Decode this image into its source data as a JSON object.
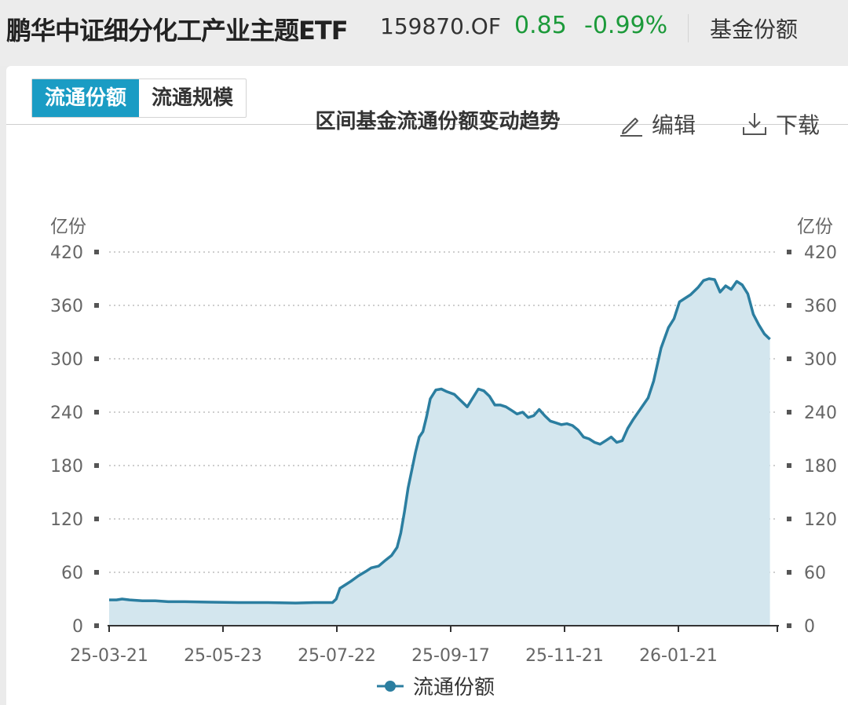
{
  "header": {
    "fund_name": "鹏华中证细分化工产业主题ETF",
    "fund_code": "159870.OF",
    "price": "0.85",
    "change": "-0.99%",
    "link": "基金份额"
  },
  "tabs": [
    {
      "label": "流通份额",
      "active": true
    },
    {
      "label": "流通规模",
      "active": false
    }
  ],
  "toolbar": {
    "edit_label": "编辑",
    "download_label": "下载"
  },
  "colors": {
    "line": "#2b7ea0",
    "fill": "#d3e6ee",
    "up": "#1c9a3a",
    "tab_active": "#1a9cc4"
  },
  "chart_data": {
    "type": "area",
    "title": "区间基金流通份额变动趋势",
    "unit_left": "亿份",
    "unit_right": "亿份",
    "ylim": [
      0,
      420
    ],
    "yticks": [
      0,
      60,
      120,
      180,
      240,
      300,
      360,
      420
    ],
    "xtick_labels": [
      "25-03-21",
      "25-05-23",
      "25-07-22",
      "25-09-17",
      "25-11-21",
      "26-01-21"
    ],
    "xlim": [
      "2025-03-21",
      "2026-03-18"
    ],
    "grid": true,
    "legend_position": "bottom",
    "series": [
      {
        "name": "流通份额",
        "points": [
          [
            "2025-03-21",
            29
          ],
          [
            "2025-03-25",
            29
          ],
          [
            "2025-03-28",
            30
          ],
          [
            "2025-04-01",
            29
          ],
          [
            "2025-04-08",
            28
          ],
          [
            "2025-04-15",
            28
          ],
          [
            "2025-04-22",
            27
          ],
          [
            "2025-05-01",
            27
          ],
          [
            "2025-05-15",
            26.5
          ],
          [
            "2025-05-30",
            26
          ],
          [
            "2025-06-15",
            26
          ],
          [
            "2025-06-30",
            25.5
          ],
          [
            "2025-07-10",
            26
          ],
          [
            "2025-07-20",
            26
          ],
          [
            "2025-07-22",
            30
          ],
          [
            "2025-07-24",
            42
          ],
          [
            "2025-07-27",
            46
          ],
          [
            "2025-07-30",
            50
          ],
          [
            "2025-08-03",
            56
          ],
          [
            "2025-08-07",
            61
          ],
          [
            "2025-08-10",
            65
          ],
          [
            "2025-08-14",
            67
          ],
          [
            "2025-08-18",
            74
          ],
          [
            "2025-08-21",
            79
          ],
          [
            "2025-08-24",
            88
          ],
          [
            "2025-08-26",
            104
          ],
          [
            "2025-08-28",
            128
          ],
          [
            "2025-08-30",
            155
          ],
          [
            "2025-09-01",
            175
          ],
          [
            "2025-09-03",
            195
          ],
          [
            "2025-09-05",
            212
          ],
          [
            "2025-09-07",
            218
          ],
          [
            "2025-09-09",
            235
          ],
          [
            "2025-09-11",
            255
          ],
          [
            "2025-09-14",
            265
          ],
          [
            "2025-09-17",
            266
          ],
          [
            "2025-09-20",
            263
          ],
          [
            "2025-09-24",
            260
          ],
          [
            "2025-09-28",
            252
          ],
          [
            "2025-10-01",
            246
          ],
          [
            "2025-10-04",
            256
          ],
          [
            "2025-10-07",
            266
          ],
          [
            "2025-10-10",
            264
          ],
          [
            "2025-10-13",
            258
          ],
          [
            "2025-10-16",
            248
          ],
          [
            "2025-10-19",
            248
          ],
          [
            "2025-10-22",
            246
          ],
          [
            "2025-10-25",
            242
          ],
          [
            "2025-10-28",
            238
          ],
          [
            "2025-10-31",
            240
          ],
          [
            "2025-11-03",
            234
          ],
          [
            "2025-11-06",
            236
          ],
          [
            "2025-11-09",
            243
          ],
          [
            "2025-11-12",
            236
          ],
          [
            "2025-11-15",
            230
          ],
          [
            "2025-11-18",
            228
          ],
          [
            "2025-11-21",
            226
          ],
          [
            "2025-11-24",
            227
          ],
          [
            "2025-11-27",
            225
          ],
          [
            "2025-11-30",
            220
          ],
          [
            "2025-12-03",
            212
          ],
          [
            "2025-12-06",
            210
          ],
          [
            "2025-12-09",
            206
          ],
          [
            "2025-12-12",
            204
          ],
          [
            "2025-12-15",
            208
          ],
          [
            "2025-12-18",
            212
          ],
          [
            "2025-12-21",
            206
          ],
          [
            "2025-12-24",
            208
          ],
          [
            "2025-12-27",
            222
          ],
          [
            "2025-12-30",
            232
          ],
          [
            "2026-01-03",
            244
          ],
          [
            "2026-01-07",
            256
          ],
          [
            "2026-01-10",
            275
          ],
          [
            "2026-01-14",
            312
          ],
          [
            "2026-01-18",
            335
          ],
          [
            "2026-01-21",
            345
          ],
          [
            "2026-01-24",
            364
          ],
          [
            "2026-01-27",
            368
          ],
          [
            "2026-01-30",
            372
          ],
          [
            "2026-02-03",
            380
          ],
          [
            "2026-02-06",
            388
          ],
          [
            "2026-02-09",
            390
          ],
          [
            "2026-02-12",
            389
          ],
          [
            "2026-02-15",
            375
          ],
          [
            "2026-02-18",
            382
          ],
          [
            "2026-02-21",
            378
          ],
          [
            "2026-02-24",
            387
          ],
          [
            "2026-02-27",
            383
          ],
          [
            "2026-03-02",
            373
          ],
          [
            "2026-03-05",
            350
          ],
          [
            "2026-03-08",
            338
          ],
          [
            "2026-03-11",
            328
          ],
          [
            "2026-03-14",
            322
          ]
        ]
      }
    ]
  }
}
